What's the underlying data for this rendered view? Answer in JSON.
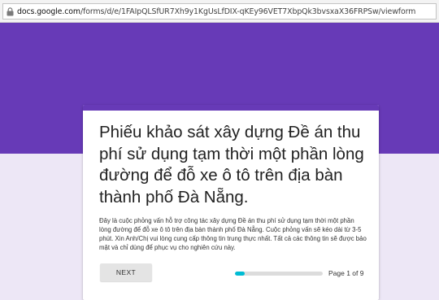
{
  "browser": {
    "url_host": "docs.google.com",
    "url_path": "/forms/d/e/1FAIpQLSfUR7Xh9y1KgUsLfDIX-qKEy96VET7XbpQk3bvsxaX36FRPSw/viewform",
    "lock_icon": "lock-icon"
  },
  "colors": {
    "theme": "#673ab7",
    "background": "#ede7f6",
    "progress": "#00bcd4"
  },
  "form": {
    "title": "Phiếu khảo sát xây dựng Đề án thu phí sử dụng tạm thời một phần lòng đường để đỗ xe ô tô trên địa bàn thành phố Đà Nẵng.",
    "description": "Đây là cuộc phỏng vấn hỗ trợ công tác xây dựng Đề án thu phí sử dụng tạm thời một phần lòng đường để đỗ xe ô tô trên địa bàn thành phố Đà Nẵng. Cuộc phỏng vấn sẽ kéo dài từ 3-5 phút. Xin Anh/Chị vui lòng cung cấp thông tin trung thực nhất. Tất cả các thông tin sẽ được bảo mật và chỉ dùng để phục vụ cho nghiên cứu này.",
    "next_label": "NEXT",
    "page_label": "Page 1 of 9",
    "progress_fraction": 0.111
  }
}
